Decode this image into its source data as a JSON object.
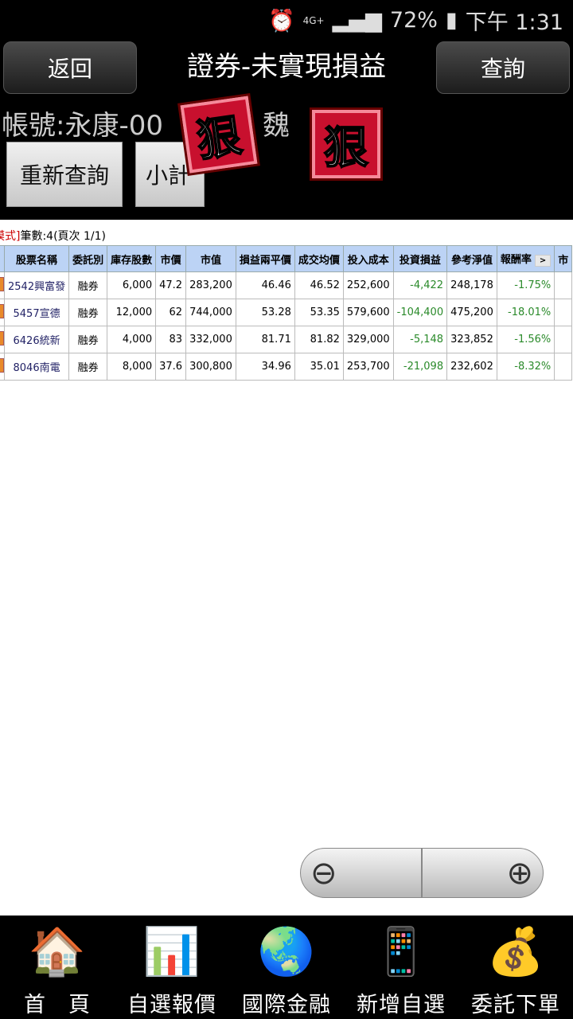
{
  "status": {
    "signal": "4G+",
    "battery": "72%",
    "time": "下午 1:31"
  },
  "header": {
    "back": "返回",
    "title": "證券-未實現損益",
    "query": "查詢"
  },
  "account": {
    "label": "帳號:永康-00",
    "name": "魏"
  },
  "actions": {
    "requery": "重新查詢",
    "subtotal": "小計"
  },
  "stamps": [
    "狠",
    "狠"
  ],
  "info": {
    "mode": "模式]",
    "count": "筆數:4(頁次 1/1)"
  },
  "table": {
    "headers": [
      "股票名稱",
      "委託別",
      "庫存股數",
      "市價",
      "市值",
      "損益兩平價",
      "成交均價",
      "投入成本",
      "投資損益",
      "參考淨值",
      "報酬率",
      "市"
    ],
    "more": ">",
    "rows": [
      [
        "2542興富發",
        "融券",
        "6,000",
        "47.2",
        "283,200",
        "46.46",
        "46.52",
        "252,600",
        "-4,422",
        "248,178",
        "-1.75%"
      ],
      [
        "5457宣德",
        "融券",
        "12,000",
        "62",
        "744,000",
        "53.28",
        "53.35",
        "579,600",
        "-104,400",
        "475,200",
        "-18.01%"
      ],
      [
        "6426統新",
        "融券",
        "4,000",
        "83",
        "332,000",
        "81.71",
        "81.82",
        "329,000",
        "-5,148",
        "323,852",
        "-1.56%"
      ],
      [
        "8046南電",
        "融券",
        "8,000",
        "37.6",
        "300,800",
        "34.96",
        "35.01",
        "253,700",
        "-21,098",
        "232,602",
        "-8.32%"
      ]
    ]
  },
  "nav": [
    {
      "label": "首　頁",
      "icon": "home-icon"
    },
    {
      "label": "自選報價",
      "icon": "chart-icon"
    },
    {
      "label": "國際金融",
      "icon": "globe-icon"
    },
    {
      "label": "新增自選",
      "icon": "phone-add-icon"
    },
    {
      "label": "委託下單",
      "icon": "coins-icon"
    }
  ],
  "colors": {
    "header_bg": "#bcd3f5",
    "loss": "#2a8a2a"
  }
}
